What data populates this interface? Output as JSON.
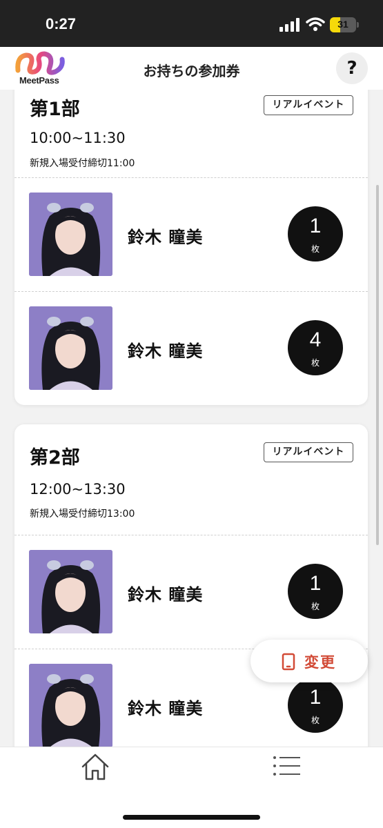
{
  "status_bar": {
    "time": "0:27",
    "battery": "31"
  },
  "header": {
    "logo_text": "MeetPass",
    "title": "お持ちの参加券",
    "help_label": "?"
  },
  "sessions": [
    {
      "part": "第1部",
      "badge": "リアルイベント",
      "time_range": "10:00~11:30",
      "deadline": "新規入場受付締切11:00",
      "members": [
        {
          "name": "鈴木 瞳美",
          "count": "1",
          "unit": "枚"
        },
        {
          "name": "鈴木 瞳美",
          "count": "4",
          "unit": "枚"
        }
      ]
    },
    {
      "part": "第2部",
      "badge": "リアルイベント",
      "time_range": "12:00~13:30",
      "deadline": "新規入場受付締切13:00",
      "members": [
        {
          "name": "鈴木 瞳美",
          "count": "1",
          "unit": "枚"
        },
        {
          "name": "鈴木 瞳美",
          "count": "1",
          "unit": "枚"
        }
      ]
    }
  ],
  "change_button": {
    "label": "変更",
    "icon": "phone-icon"
  },
  "bottom_nav": {
    "items": [
      {
        "icon": "home-icon"
      },
      {
        "icon": "menu-icon"
      }
    ]
  },
  "colors": {
    "accent": "#d24a36",
    "status_bar": "#222222",
    "badge_circle": "#111111",
    "photo_bg": "#8d7fc6"
  }
}
